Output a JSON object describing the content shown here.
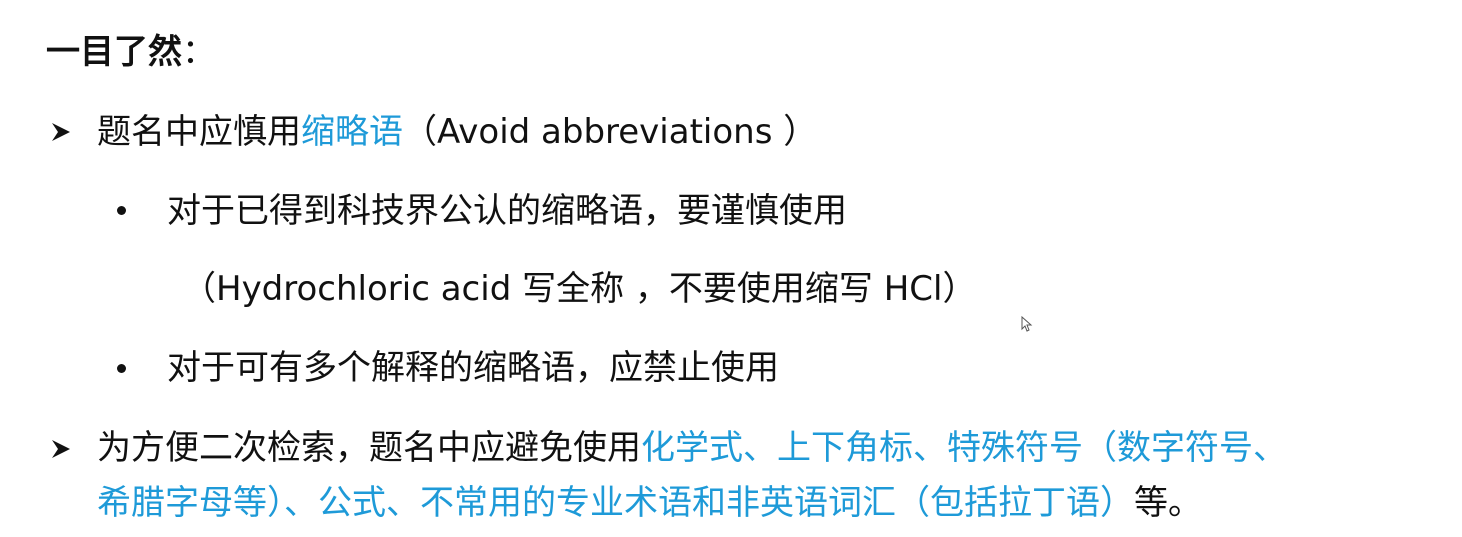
{
  "heading": {
    "title": "一目了然",
    "colon": "："
  },
  "items": [
    {
      "marker": "arrow",
      "text_before": "题名中应慎用",
      "highlight": "缩略语",
      "text_after": "（Avoid abbreviations ）"
    },
    {
      "marker": "bullet",
      "text": "对于已得到科技界公认的缩略语，要谨慎使用"
    },
    {
      "marker": "none",
      "text": "（Hydrochloric acid 写全称 ，不要使用缩写 HCl）"
    },
    {
      "marker": "bullet",
      "text": "对于可有多个解释的缩略语，应禁止使用"
    },
    {
      "marker": "arrow",
      "text_before": "为方便二次检索，题名中应避免使用",
      "highlight_line1": "化学式、上下角标、特殊符号（数字符号、",
      "highlight_line2": "希腊字母等）、公式、不常用的专业术语和非英语词汇（包括拉丁语）",
      "text_after": "等。"
    }
  ],
  "colors": {
    "text": "#111111",
    "highlight": "#1e9ad8"
  },
  "icons": [
    "arrow-bullet-icon",
    "dot-bullet-icon",
    "mouse-cursor-icon"
  ]
}
